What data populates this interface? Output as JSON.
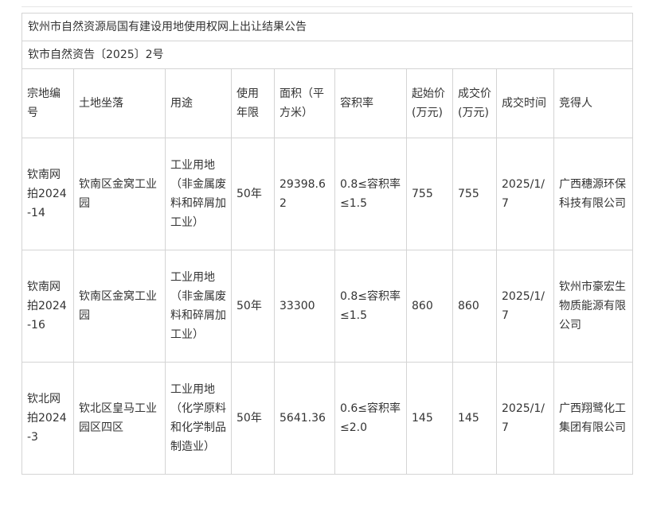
{
  "announcement": {
    "title": "钦州市自然资源局国有建设用地使用权网上出让结果公告",
    "doc_number": "钦市自然资告〔2025〕2号"
  },
  "table": {
    "headers": [
      "宗地编号",
      "土地坐落",
      "用途",
      "使用年限",
      "面积（平方米）",
      "容积率",
      "起始价(万元)",
      "成交价(万元)",
      "成交时间",
      "竞得人"
    ],
    "rows": [
      [
        "钦南网拍2024-14",
        "钦南区金窝工业园",
        "工业用地（非金属废料和碎屑加工业）",
        "50年",
        "29398.62",
        "0.8≤容积率≤1.5",
        "755",
        "755",
        "2025/1/7",
        "广西穗源环保科技有限公司"
      ],
      [
        "钦南网拍2024-16",
        "钦南区金窝工业园",
        "工业用地（非金属废料和碎屑加工业）",
        "50年",
        "33300",
        "0.8≤容积率≤1.5",
        "860",
        "860",
        "2025/1/7",
        "钦州市豪宏生物质能源有限公司"
      ],
      [
        "钦北网拍2024-3",
        "钦北区皇马工业园区四区",
        "工业用地（化学原料和化学制品制造业）",
        "50年",
        "5641.36",
        "0.6≤容积率≤2.0",
        "145",
        "145",
        "2025/1/7",
        "广西翔鹭化工集团有限公司"
      ]
    ]
  }
}
